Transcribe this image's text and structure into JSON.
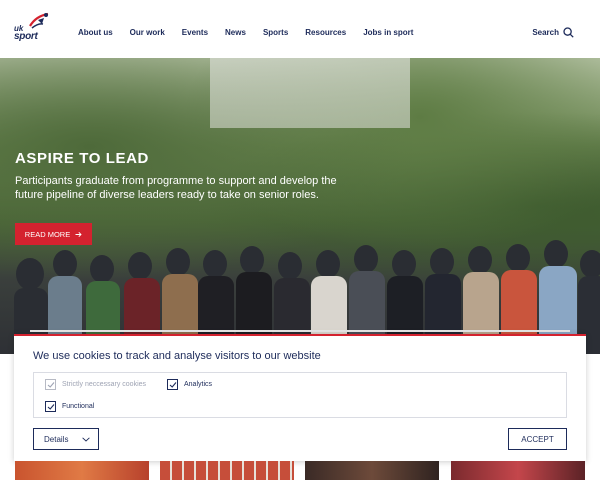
{
  "header": {
    "logo": {
      "line1": "uk",
      "line2": "sport"
    },
    "nav": [
      {
        "label": "About us"
      },
      {
        "label": "Our work"
      },
      {
        "label": "Events"
      },
      {
        "label": "News"
      },
      {
        "label": "Sports"
      },
      {
        "label": "Resources"
      },
      {
        "label": "Jobs in sport"
      }
    ],
    "search_label": "Search",
    "search_icon": "search-icon"
  },
  "hero": {
    "title": "ASPIRE TO LEAD",
    "text": "Participants graduate from programme to support and develop the future pipeline of diverse leaders ready to take on senior roles.",
    "button_label": "READ MORE",
    "button_icon": "arrow-right-icon"
  },
  "cookie": {
    "title": "We use cookies to track and analyse visitors to our website",
    "options": [
      {
        "label": "Strictly neccessary cookies",
        "checked": true,
        "disabled": true
      },
      {
        "label": "Analytics",
        "checked": true,
        "disabled": false
      },
      {
        "label": "Functional",
        "checked": true,
        "disabled": false
      }
    ],
    "details_label": "Details",
    "details_icon": "chevron-down-icon",
    "accept_label": "ACCEPT"
  },
  "colors": {
    "navy": "#1d2b5a",
    "red": "#d4222f",
    "white": "#ffffff"
  }
}
